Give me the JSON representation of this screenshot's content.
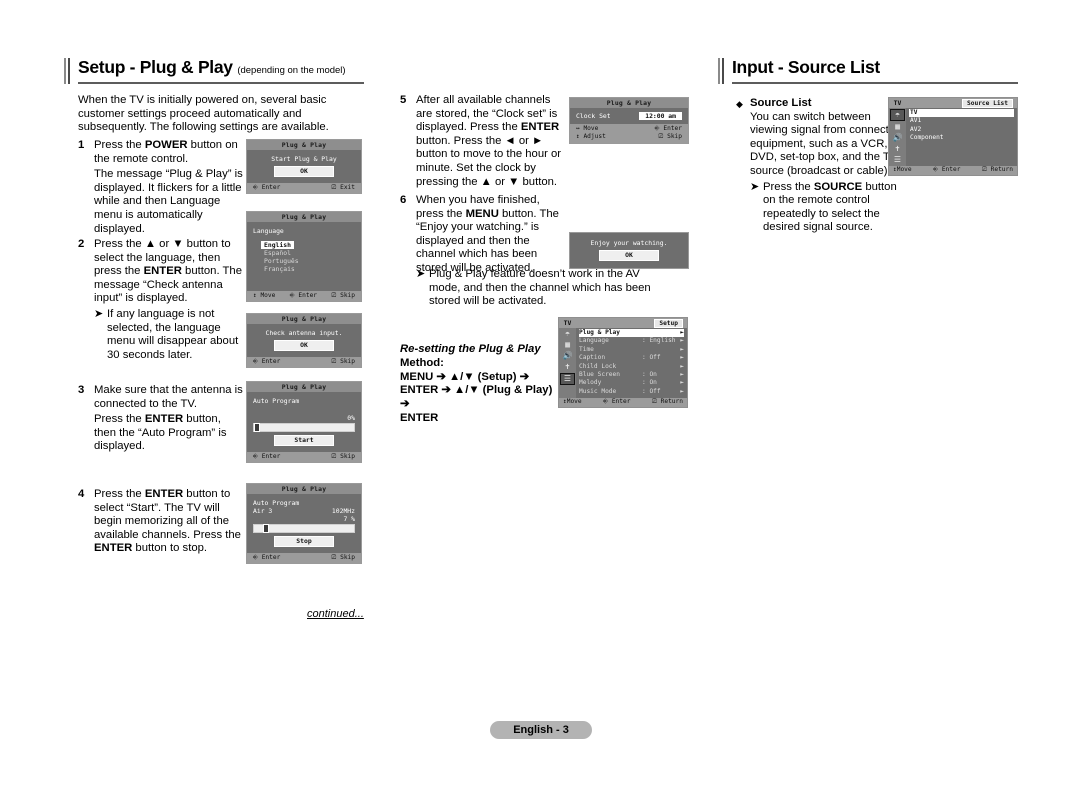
{
  "left_section": {
    "title": "Setup - Plug & Play",
    "title_sub": "(depending on the model)",
    "intro": "When the TV is initially powered on, several basic customer settings proceed automatically and subsequently. The following settings are available.",
    "steps": [
      {
        "num": "1",
        "line1_a": "Press the ",
        "line1_b": "POWER",
        "line1_c": " button on the remote control.",
        "line2": "The message “Plug & Play” is displayed. It flickers for a little while and then Language menu is automatically displayed."
      },
      {
        "num": "2",
        "line1_a": "Press the ▲ or ▼ button to select the language, then press the ",
        "line1_b": "ENTER",
        "line1_c": " button. The message “Check antenna input” is displayed.",
        "note": "If any language is not selected, the language menu will disappear about 30 seconds later."
      },
      {
        "num": "3",
        "line1": "Make sure that the antenna is connected to the TV.",
        "line2_a": "Press the ",
        "line2_b": "ENTER",
        "line2_c": " button, then the “Auto Program” is displayed."
      },
      {
        "num": "4",
        "line1_a": "Press the ",
        "line1_b": "ENTER",
        "line1_c": " button to select “Start”. The TV will begin memorizing all of the available channels. Press the ",
        "line1_d": "ENTER",
        "line1_e": " button to stop."
      }
    ],
    "continued": "continued..."
  },
  "middle_section": {
    "steps": [
      {
        "num": "5",
        "a": "After all available channels are stored, the “Clock set” is displayed. Press the ",
        "b": "ENTER",
        "c": " button. Press the ◄ or ► button to move to the hour or minute. Set the clock by pressing the ▲ or ▼ button."
      },
      {
        "num": "6",
        "a": "When you have finished, press the ",
        "b": "MENU",
        "c": " button. The “Enjoy your watching.” is displayed and then the channel which has been stored will be activated."
      }
    ],
    "note": "Plug & Play feature doesn’t work in the AV mode, and then the channel which has been stored will be activated.",
    "resetting": {
      "heading": "Re-setting the Plug & Play",
      "method_label": "Method:",
      "line1": "MENU ➔ ▲/▼ (Setup) ➔",
      "line2": "ENTER ➔ ▲/▼ (Plug & Play) ➔",
      "line3": "ENTER"
    }
  },
  "right_section": {
    "title": "Input - Source List",
    "bullet_glyph": "◆",
    "heading": "Source List",
    "body": "You can switch between viewing signal from connected equipment, such as a VCR, DVD, set-top box, and the TV source (broadcast or cable).",
    "note_a": "Press the ",
    "note_b": "SOURCE",
    "note_c": " button on the remote control repeatedly to select the desired signal source."
  },
  "osd": {
    "start": {
      "title": "Plug & Play",
      "message": "Start Plug & Play",
      "button": "OK",
      "foot_left": "Enter",
      "foot_right": "Exit"
    },
    "language": {
      "title": "Plug & Play",
      "label": "Language",
      "options": [
        "English",
        "Español",
        "Português",
        "Français"
      ],
      "selected": "English",
      "foot_move": "Move",
      "foot_enter": "Enter",
      "foot_skip": "Skip"
    },
    "antenna": {
      "title": "Plug & Play",
      "message": "Check antenna input.",
      "button": "OK",
      "foot_left": "Enter",
      "foot_right": "Skip"
    },
    "autoprogram1": {
      "title": "Plug & Play",
      "label": "Auto Program",
      "percent": "0%",
      "button": "Start",
      "foot_left": "Enter",
      "foot_right": "Skip"
    },
    "autoprogram2": {
      "title": "Plug & Play",
      "label": "Auto Program",
      "channel": "Air 3",
      "freq": "102MHz",
      "percent": "7 %",
      "button": "Stop",
      "foot_left": "Enter",
      "foot_right": "Skip"
    },
    "clockset": {
      "title": "Plug & Play",
      "label": "Clock Set",
      "value": "12:00  am",
      "foot_move": "Move",
      "foot_adjust": "Adjust",
      "foot_enter": "Enter",
      "foot_skip": "Skip"
    },
    "enjoy": {
      "message": "Enjoy your watching.",
      "button": "OK"
    },
    "setup_menu": {
      "tv_label": "TV",
      "caption": "Setup",
      "items": [
        {
          "label": "Plug & Play",
          "value": "",
          "arrow": "►",
          "highlight": true
        },
        {
          "label": "Language",
          "value": ": English",
          "arrow": "►",
          "highlight": false
        },
        {
          "label": "Time",
          "value": "",
          "arrow": "►",
          "highlight": false
        },
        {
          "label": "Caption",
          "value": ": Off",
          "arrow": "►",
          "highlight": false
        },
        {
          "label": "Child Lock",
          "value": "",
          "arrow": "►",
          "highlight": false
        },
        {
          "label": "Blue Screen",
          "value": ": On",
          "arrow": "►",
          "highlight": false
        },
        {
          "label": "Melody",
          "value": ": On",
          "arrow": "►",
          "highlight": false
        },
        {
          "label": "Music Mode",
          "value": ": Off",
          "arrow": "►",
          "highlight": false
        }
      ],
      "rail_icons": [
        "picture-icon",
        "screen-icon",
        "sound-icon",
        "channel-icon",
        "setup-icon"
      ],
      "active_rail_index": 4,
      "foot_move": "Move",
      "foot_enter": "Enter",
      "foot_return": "Return"
    },
    "source_menu": {
      "tv_label": "TV",
      "caption": "Source List",
      "items": [
        "TV",
        "AV1",
        "AV2",
        "Component"
      ],
      "selected": "TV",
      "rail_icons": [
        "picture-icon",
        "screen-icon",
        "sound-icon",
        "channel-icon",
        "setup-icon"
      ],
      "active_rail_index": 0,
      "foot_move": "Move",
      "foot_enter": "Enter",
      "foot_return": "Return"
    }
  },
  "footer": {
    "page_label": "English - 3"
  }
}
